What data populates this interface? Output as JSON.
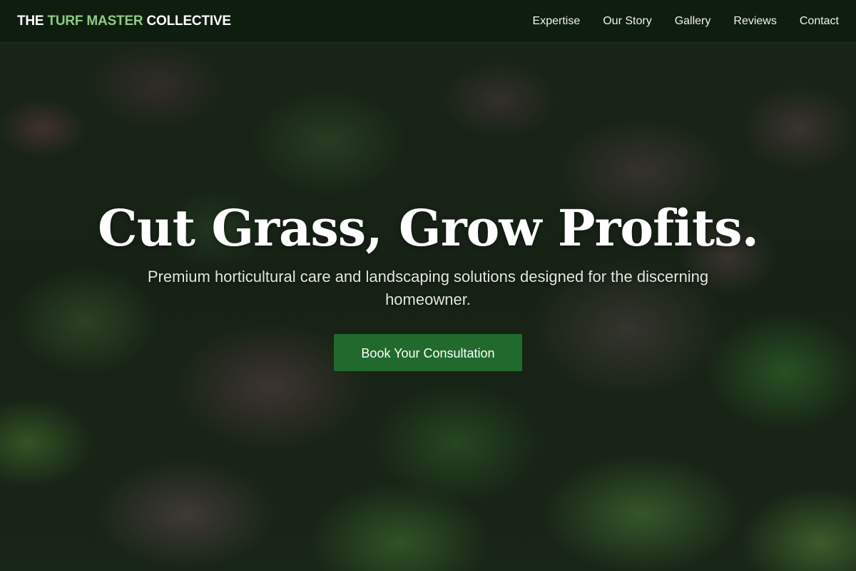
{
  "header": {
    "brand": {
      "part1": "THE ",
      "part2": "TURF MASTER",
      "part3": " COLLECTIVE"
    },
    "nav": [
      {
        "label": "Expertise"
      },
      {
        "label": "Our Story"
      },
      {
        "label": "Gallery"
      },
      {
        "label": "Reviews"
      },
      {
        "label": "Contact"
      }
    ]
  },
  "hero": {
    "title": "Cut Grass, Grow Profits.",
    "subtitle": "Premium horticultural care and landscaping solutions designed for the discerning homeowner.",
    "cta_label": "Book Your Consultation",
    "background_image": "lettuce-leaves-photo"
  },
  "colors": {
    "header_bg": "#0e1e0e",
    "brand_accent": "#8fcb85",
    "cta_bg": "#1f6a2c",
    "text_primary": "#ffffff"
  }
}
